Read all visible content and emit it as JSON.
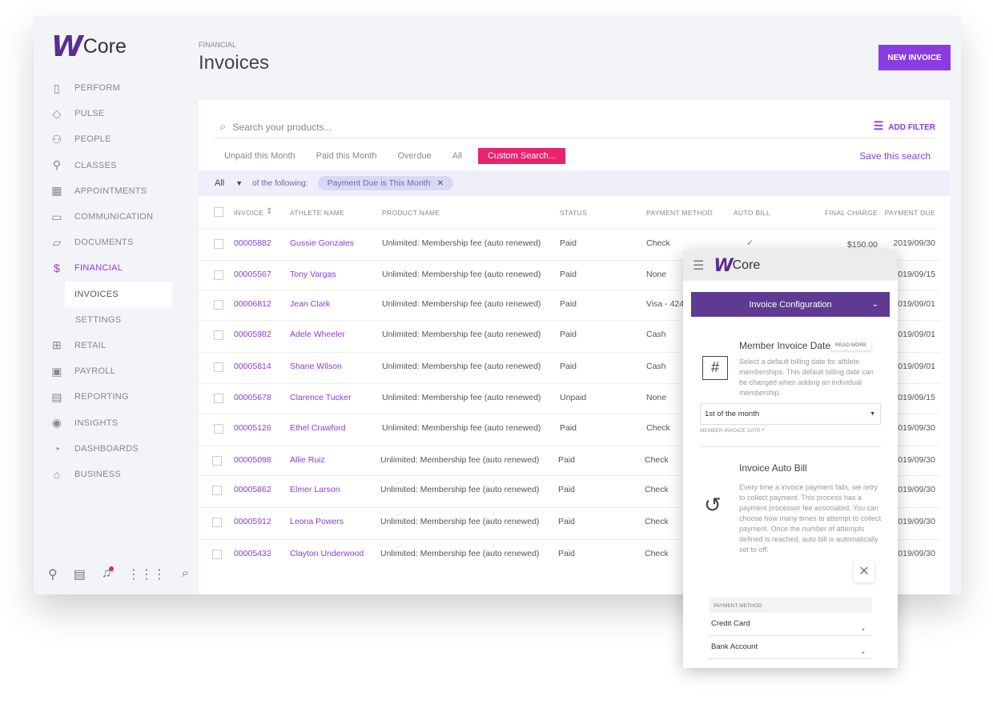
{
  "brand": {
    "logo_mark": "W",
    "logo_text": "Core"
  },
  "sidebar": {
    "items": [
      {
        "label": "PERFORM",
        "icon": "clipboard-clock-icon",
        "glyph": "▯"
      },
      {
        "label": "PULSE",
        "icon": "pulse-icon",
        "glyph": "◇"
      },
      {
        "label": "PEOPLE",
        "icon": "people-icon",
        "glyph": "⚇"
      },
      {
        "label": "CLASSES",
        "icon": "classes-icon",
        "glyph": "⚲"
      },
      {
        "label": "APPOINTMENTS",
        "icon": "calendar-icon",
        "glyph": "▦"
      },
      {
        "label": "COMMUNICATION",
        "icon": "chat-icon",
        "glyph": "▭"
      },
      {
        "label": "DOCUMENTS",
        "icon": "folder-icon",
        "glyph": "▱"
      },
      {
        "label": "FINANCIAL",
        "icon": "dollar-icon",
        "glyph": "$"
      },
      {
        "label": "INVOICES"
      },
      {
        "label": "SETTINGS"
      },
      {
        "label": "RETAIL",
        "icon": "retail-icon",
        "glyph": "⊞"
      },
      {
        "label": "PAYROLL",
        "icon": "payroll-icon",
        "glyph": "▣"
      },
      {
        "label": "REPORTING",
        "icon": "report-icon",
        "glyph": "▤"
      },
      {
        "label": "INSIGHTS",
        "icon": "eye-icon",
        "glyph": "◉"
      },
      {
        "label": "DASHBOARDS",
        "icon": "pie-chart-icon",
        "glyph": "◔"
      },
      {
        "label": "BUSINESS",
        "icon": "bank-icon",
        "glyph": "⌂"
      }
    ]
  },
  "header": {
    "breadcrumb": "FINANCIAL",
    "title": "Invoices",
    "new_invoice": "NEW INVOICE"
  },
  "search": {
    "placeholder": "Search your products...",
    "add_filter": "ADD FILTER"
  },
  "tabs": [
    "Unpaid this Month",
    "Paid this Month",
    "Overdue",
    "All",
    "Custom Search..."
  ],
  "save_search": "Save this search",
  "filter": {
    "mode": "All",
    "of": "of the following:",
    "chip": "Payment Due is This Month"
  },
  "columns": [
    "INVOICE",
    "ATHLETE NAME",
    "PRODUCT NAME",
    "STATUS",
    "PAYMENT METHOD",
    "AUTO BILL",
    "FINAL CHARGE",
    "PAYMENT DUE"
  ],
  "rows": [
    {
      "invoice": "00005882",
      "athlete": "Gussie Gonzales",
      "product": "Unlimited: Membership fee (auto renewed)",
      "status": "Paid",
      "method": "Check",
      "auto_bill": "✓",
      "charge": "$150.00",
      "due": "2019/09/30"
    },
    {
      "invoice": "00005567",
      "athlete": "Tony Vargas",
      "product": "Unlimited: Membership fee (auto renewed)",
      "status": "Paid",
      "method": "None",
      "due": "2019/09/15"
    },
    {
      "invoice": "00006812",
      "athlete": "Jean Clark",
      "product": "Unlimited: Membership fee (auto renewed)",
      "status": "Paid",
      "method": "Visa - 4242",
      "due": "2019/09/01"
    },
    {
      "invoice": "00005982",
      "athlete": "Adele Wheeler",
      "product": "Unlimited: Membership fee (auto renewed)",
      "status": "Paid",
      "method": "Cash",
      "due": "2019/09/01"
    },
    {
      "invoice": "00005814",
      "athlete": "Shane Wilson",
      "product": "Unlimited: Membership fee (auto renewed)",
      "status": "Paid",
      "method": "Cash",
      "due": "2019/09/01"
    },
    {
      "invoice": "00005678",
      "athlete": "Clarence Tucker",
      "product": "Unlimited: Membership fee (auto renewed)",
      "status": "Unpaid",
      "method": "None",
      "due": "2019/09/15"
    },
    {
      "invoice": "00005126",
      "athlete": "Ethel Crawford",
      "product": "Unlimited: Membership fee (auto renewed)",
      "status": "Paid",
      "method": "Check",
      "due": "2019/09/30"
    },
    {
      "invoice": "00005098",
      "athlete": "Allie Ruiz",
      "product": "Unlimited: Membership fee (auto renewed)",
      "status": "Paid",
      "method": "Check",
      "due": "2019/09/30"
    },
    {
      "invoice": "00005862",
      "athlete": "Elmer Larson",
      "product": "Unlimited: Membership fee (auto renewed)",
      "status": "Paid",
      "method": "Check",
      "due": "2019/09/30"
    },
    {
      "invoice": "00005912",
      "athlete": "Leona Powers",
      "product": "Unlimited: Membership fee (auto renewed)",
      "status": "Paid",
      "method": "Check",
      "due": "2019/09/30"
    },
    {
      "invoice": "00005432",
      "athlete": "Clayton Underwood",
      "product": "Unlimited: Membership fee (auto renewed)",
      "status": "Paid",
      "method": "Check",
      "due": "2019/09/30"
    }
  ],
  "panel": {
    "config_title": "Invoice Configuration",
    "member_date": {
      "title": "Member Invoice Date",
      "read_more": "READ MORE",
      "desc": "Select a default billing date for athlete memberships. This default billing date can be changed when adding an individual membership.",
      "value": "1st of the month",
      "label": "MEMBER INVOICE DATE",
      "required": "*"
    },
    "auto_bill": {
      "title": "Invoice Auto Bill",
      "desc": "Every time a invoice payment fails, we retry to collect payment. This process has a payment processor fee associated. You can choose how many times to attempt to collect payment. Once the number of attempts defined is reached, auto bill is automatically set to off."
    },
    "payment_method": {
      "label": "PAYMENT METHOD",
      "options": [
        "Credit Card",
        "Bank Account"
      ]
    }
  },
  "colors": {
    "accent": "#8a3ce0",
    "pink": "#e8246f",
    "panel_header": "#5e3a92"
  }
}
